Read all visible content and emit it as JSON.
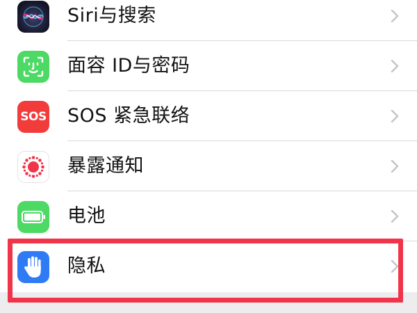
{
  "settings": {
    "items": [
      {
        "label": "Siri与搜索",
        "icon": "siri-icon"
      },
      {
        "label": "面容 ID与密码",
        "icon": "face-id-icon"
      },
      {
        "label": "SOS 紧急联络",
        "icon": "sos-icon",
        "icon_text": "SOS"
      },
      {
        "label": "暴露通知",
        "icon": "exposure-notification-icon"
      },
      {
        "label": "电池",
        "icon": "battery-icon"
      },
      {
        "label": "隐私",
        "icon": "privacy-hand-icon"
      }
    ]
  },
  "colors": {
    "highlight": "#f0354a",
    "face_id_green": "#4cd964",
    "sos_red": "#f23b3b",
    "privacy_blue": "#2f7bf5",
    "exposure_red": "#f0354a",
    "divider": "#d9d9dd",
    "chevron": "#c4c4c7"
  },
  "highlight": {
    "target": "privacy"
  }
}
